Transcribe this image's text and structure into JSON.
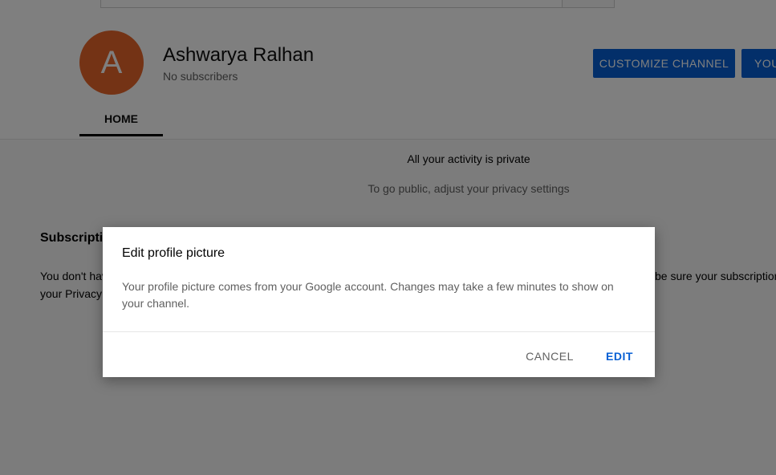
{
  "channel": {
    "avatar_letter": "A",
    "name": "Ashwarya Ralhan",
    "subscribers": "No subscribers"
  },
  "header": {
    "customize_label": "CUSTOMIZE CHANNEL",
    "videos_label": "YOUR VIDEOS"
  },
  "tabs": [
    {
      "label": "HOME",
      "active": true
    }
  ],
  "activity": {
    "title": "All your activity is private",
    "subtitle": "To go public, adjust your privacy settings"
  },
  "subscriptions": {
    "title": "Subscriptions",
    "text_left": "You don't have any subscriptions",
    "text_left_line2": "your Privacy settings",
    "text_right": "be sure your subscriptions"
  },
  "dialog": {
    "title": "Edit profile picture",
    "body": "Your profile picture comes from your Google account. Changes may take a few minutes to show on your channel.",
    "cancel_label": "CANCEL",
    "edit_label": "EDIT"
  },
  "colors": {
    "accent": "#065fd4",
    "avatar": "#e9662a",
    "overlay": "rgba(0,0,0,0.5)"
  }
}
